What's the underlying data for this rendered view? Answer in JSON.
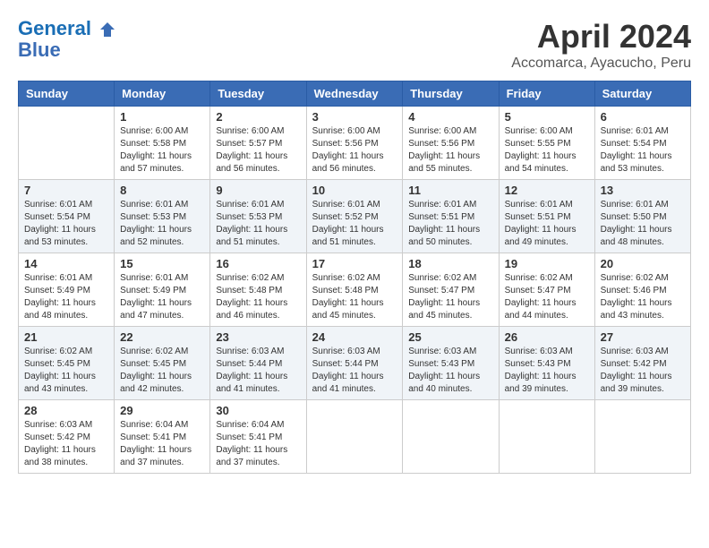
{
  "logo": {
    "line1": "General",
    "line2": "Blue"
  },
  "title": "April 2024",
  "location": "Accomarca, Ayacucho, Peru",
  "headers": [
    "Sunday",
    "Monday",
    "Tuesday",
    "Wednesday",
    "Thursday",
    "Friday",
    "Saturday"
  ],
  "weeks": [
    [
      {
        "day": "",
        "info": ""
      },
      {
        "day": "1",
        "info": "Sunrise: 6:00 AM\nSunset: 5:58 PM\nDaylight: 11 hours\nand 57 minutes."
      },
      {
        "day": "2",
        "info": "Sunrise: 6:00 AM\nSunset: 5:57 PM\nDaylight: 11 hours\nand 56 minutes."
      },
      {
        "day": "3",
        "info": "Sunrise: 6:00 AM\nSunset: 5:56 PM\nDaylight: 11 hours\nand 56 minutes."
      },
      {
        "day": "4",
        "info": "Sunrise: 6:00 AM\nSunset: 5:56 PM\nDaylight: 11 hours\nand 55 minutes."
      },
      {
        "day": "5",
        "info": "Sunrise: 6:00 AM\nSunset: 5:55 PM\nDaylight: 11 hours\nand 54 minutes."
      },
      {
        "day": "6",
        "info": "Sunrise: 6:01 AM\nSunset: 5:54 PM\nDaylight: 11 hours\nand 53 minutes."
      }
    ],
    [
      {
        "day": "7",
        "info": "Sunrise: 6:01 AM\nSunset: 5:54 PM\nDaylight: 11 hours\nand 53 minutes."
      },
      {
        "day": "8",
        "info": "Sunrise: 6:01 AM\nSunset: 5:53 PM\nDaylight: 11 hours\nand 52 minutes."
      },
      {
        "day": "9",
        "info": "Sunrise: 6:01 AM\nSunset: 5:53 PM\nDaylight: 11 hours\nand 51 minutes."
      },
      {
        "day": "10",
        "info": "Sunrise: 6:01 AM\nSunset: 5:52 PM\nDaylight: 11 hours\nand 51 minutes."
      },
      {
        "day": "11",
        "info": "Sunrise: 6:01 AM\nSunset: 5:51 PM\nDaylight: 11 hours\nand 50 minutes."
      },
      {
        "day": "12",
        "info": "Sunrise: 6:01 AM\nSunset: 5:51 PM\nDaylight: 11 hours\nand 49 minutes."
      },
      {
        "day": "13",
        "info": "Sunrise: 6:01 AM\nSunset: 5:50 PM\nDaylight: 11 hours\nand 48 minutes."
      }
    ],
    [
      {
        "day": "14",
        "info": "Sunrise: 6:01 AM\nSunset: 5:49 PM\nDaylight: 11 hours\nand 48 minutes."
      },
      {
        "day": "15",
        "info": "Sunrise: 6:01 AM\nSunset: 5:49 PM\nDaylight: 11 hours\nand 47 minutes."
      },
      {
        "day": "16",
        "info": "Sunrise: 6:02 AM\nSunset: 5:48 PM\nDaylight: 11 hours\nand 46 minutes."
      },
      {
        "day": "17",
        "info": "Sunrise: 6:02 AM\nSunset: 5:48 PM\nDaylight: 11 hours\nand 45 minutes."
      },
      {
        "day": "18",
        "info": "Sunrise: 6:02 AM\nSunset: 5:47 PM\nDaylight: 11 hours\nand 45 minutes."
      },
      {
        "day": "19",
        "info": "Sunrise: 6:02 AM\nSunset: 5:47 PM\nDaylight: 11 hours\nand 44 minutes."
      },
      {
        "day": "20",
        "info": "Sunrise: 6:02 AM\nSunset: 5:46 PM\nDaylight: 11 hours\nand 43 minutes."
      }
    ],
    [
      {
        "day": "21",
        "info": "Sunrise: 6:02 AM\nSunset: 5:45 PM\nDaylight: 11 hours\nand 43 minutes."
      },
      {
        "day": "22",
        "info": "Sunrise: 6:02 AM\nSunset: 5:45 PM\nDaylight: 11 hours\nand 42 minutes."
      },
      {
        "day": "23",
        "info": "Sunrise: 6:03 AM\nSunset: 5:44 PM\nDaylight: 11 hours\nand 41 minutes."
      },
      {
        "day": "24",
        "info": "Sunrise: 6:03 AM\nSunset: 5:44 PM\nDaylight: 11 hours\nand 41 minutes."
      },
      {
        "day": "25",
        "info": "Sunrise: 6:03 AM\nSunset: 5:43 PM\nDaylight: 11 hours\nand 40 minutes."
      },
      {
        "day": "26",
        "info": "Sunrise: 6:03 AM\nSunset: 5:43 PM\nDaylight: 11 hours\nand 39 minutes."
      },
      {
        "day": "27",
        "info": "Sunrise: 6:03 AM\nSunset: 5:42 PM\nDaylight: 11 hours\nand 39 minutes."
      }
    ],
    [
      {
        "day": "28",
        "info": "Sunrise: 6:03 AM\nSunset: 5:42 PM\nDaylight: 11 hours\nand 38 minutes."
      },
      {
        "day": "29",
        "info": "Sunrise: 6:04 AM\nSunset: 5:41 PM\nDaylight: 11 hours\nand 37 minutes."
      },
      {
        "day": "30",
        "info": "Sunrise: 6:04 AM\nSunset: 5:41 PM\nDaylight: 11 hours\nand 37 minutes."
      },
      {
        "day": "",
        "info": ""
      },
      {
        "day": "",
        "info": ""
      },
      {
        "day": "",
        "info": ""
      },
      {
        "day": "",
        "info": ""
      }
    ]
  ]
}
